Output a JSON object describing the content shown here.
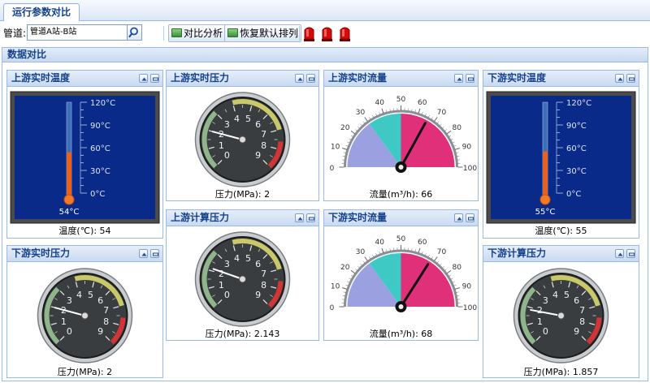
{
  "tabs": [
    {
      "label": "运行参数对比"
    }
  ],
  "toolbar": {
    "pipeline_label": "管道:",
    "pipeline_value": "管道A站-B站",
    "compare_label": "对比分析",
    "restore_label": "恢复默认排列"
  },
  "main_panel": {
    "title": "数据对比"
  },
  "colors": {
    "thermo_bg": "#0a2a8a",
    "gauge_face": "#3a3d3f",
    "flow_low": "#9aa0e0",
    "flow_mid": "#3fc9c4",
    "flow_high": "#e0307a"
  },
  "portlets": {
    "up_temp": {
      "title": "上游实时温度",
      "value": 54,
      "readout": "54°C",
      "caption": "温度(℃): 54"
    },
    "down_temp": {
      "title": "下游实时温度",
      "value": 55,
      "readout": "55°C",
      "caption": "温度(℃): 55"
    },
    "up_press": {
      "title": "上游实时压力",
      "value": 2,
      "caption": "压力(MPa): 2"
    },
    "up_calc_press": {
      "title": "上游计算压力",
      "value": 2.143,
      "caption": "压力(MPa): 2.143"
    },
    "down_press": {
      "title": "下游实时压力",
      "value": 2,
      "caption": "压力(MPa): 2"
    },
    "down_calc_press": {
      "title": "下游计算压力",
      "value": 1.857,
      "caption": "压力(MPa): 1.857"
    },
    "up_flow": {
      "title": "上游实时流量",
      "value": 66,
      "caption": "流量(m³/h): 66"
    },
    "down_flow": {
      "title": "下游实时流量",
      "value": 68,
      "caption": "流量(m³/h): 68"
    }
  },
  "thermometer_ticks": [
    "120°C",
    "90°C",
    "60°C",
    "30°C",
    "0°C"
  ],
  "pressure_ticks": [
    "0",
    "1",
    "2",
    "3",
    "4",
    "5",
    "6",
    "7",
    "8",
    "9"
  ],
  "flow_ticks": [
    "0",
    "10",
    "20",
    "30",
    "40",
    "50",
    "60",
    "70",
    "80",
    "90",
    "100"
  ]
}
